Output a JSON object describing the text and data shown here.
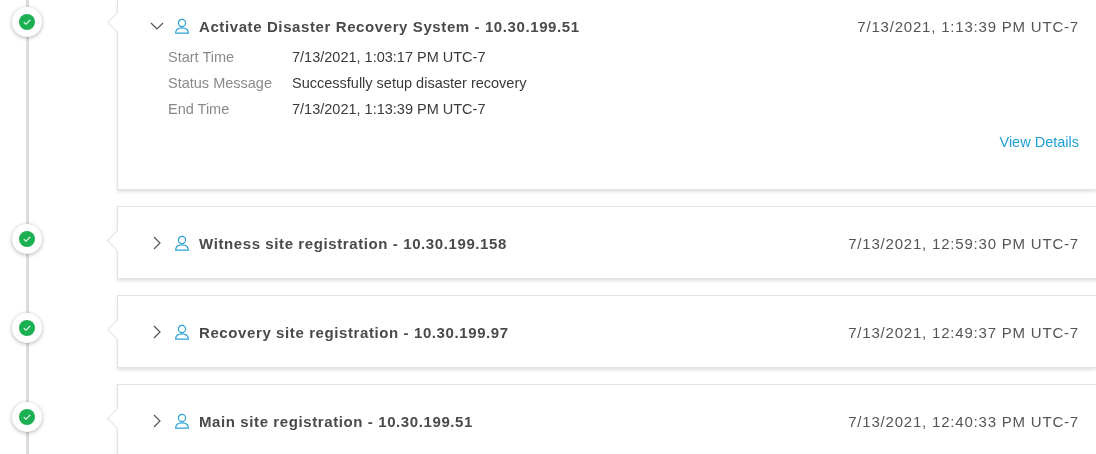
{
  "events": [
    {
      "title": "Activate Disaster Recovery System - 10.30.199.51",
      "time": "7/13/2021, 1:13:39 PM UTC-7",
      "success": true,
      "expanded": true,
      "details": [
        {
          "label": "Start Time",
          "value": "7/13/2021, 1:03:17 PM UTC-7"
        },
        {
          "label": "Status Message",
          "value": "Successfully setup disaster recovery"
        },
        {
          "label": "End Time",
          "value": "7/13/2021, 1:13:39 PM UTC-7"
        }
      ],
      "link": "View Details"
    },
    {
      "title": "Witness site registration - 10.30.199.158",
      "time": "7/13/2021, 12:59:30 PM UTC-7",
      "success": true,
      "expanded": false
    },
    {
      "title": "Recovery site registration - 10.30.199.97",
      "time": "7/13/2021, 12:49:37 PM UTC-7",
      "success": true,
      "expanded": false
    },
    {
      "title": "Main site registration - 10.30.199.51",
      "time": "7/13/2021, 12:40:33 PM UTC-7",
      "success": true,
      "expanded": false
    }
  ]
}
